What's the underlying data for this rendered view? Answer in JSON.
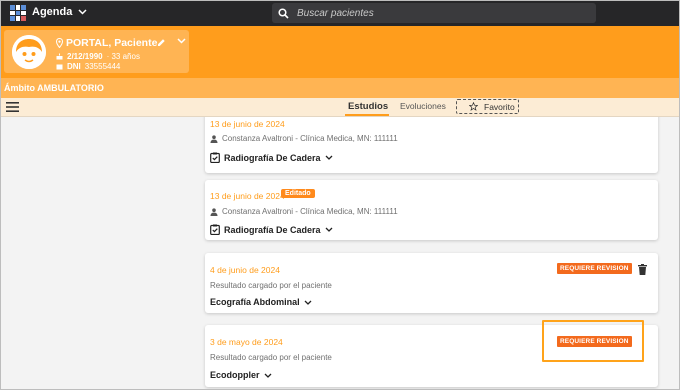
{
  "topbar": {
    "app_title": "Agenda",
    "app_icon": "grid-logo-icon",
    "search_placeholder": "Buscar pacientes"
  },
  "patient": {
    "name": "PORTAL, Paciente",
    "dob": "2/12/1990",
    "age": "· 33 años",
    "dni_label": "DNI",
    "dni": "33555444"
  },
  "ambito": "Ámbito AMBULATORIO",
  "tabs": {
    "estudios": "Estudios",
    "evoluciones": "Evoluciones",
    "favorito": "Favorito"
  },
  "cards": [
    {
      "date": "13 de junio de 2024",
      "sub": "Constanza Avaltroni - Clínica Medica, MN: 111111",
      "title": "Radiografía De Cadera",
      "badge": ""
    },
    {
      "date": "13 de junio de 2024",
      "sub": "Constanza Avaltroni - Clínica Medica, MN: 111111",
      "title": "Radiografía De Cadera",
      "badge": "Editado"
    },
    {
      "date": "4 de junio de 2024",
      "sub": "Resultado cargado por el paciente",
      "title": "Ecografía Abdominal",
      "badge": "REQUIERE REVISION"
    },
    {
      "date": "3 de mayo de 2024",
      "sub": "Resultado cargado por el paciente",
      "title": "Ecodoppler",
      "badge": "REQUIERE REVISION"
    }
  ],
  "colors": {
    "accent_orange": "#ff9d1c",
    "header_dark": "#262628",
    "badge_orange": "#f36a1d"
  }
}
